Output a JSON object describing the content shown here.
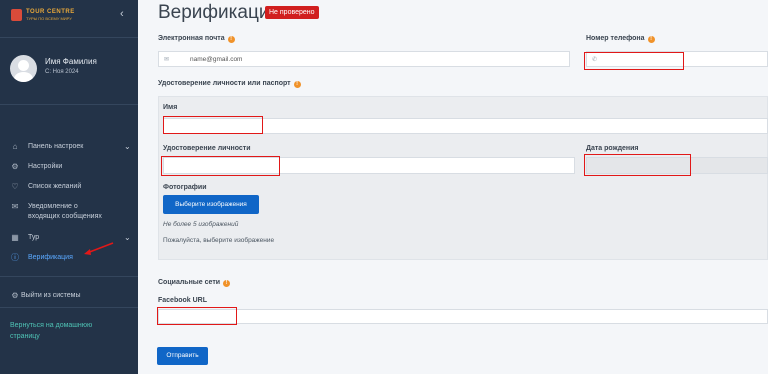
{
  "sidebar": {
    "brand_title": "TOUR CENTRE",
    "brand_sub": "ТУРЫ ПО ВСЕМУ МИРУ",
    "user_name": "Имя Фамилия",
    "user_since": "С: Ноя 2024",
    "items": [
      {
        "label": "Панель настроек",
        "icon": "house-icon"
      },
      {
        "label": "Настройки",
        "icon": "gear-icon"
      },
      {
        "label": "Список желаний",
        "icon": "heart-icon"
      },
      {
        "label": "Уведомление о входящих сообщениях",
        "icon": "message-icon"
      },
      {
        "label": "Тур",
        "icon": "map-icon"
      },
      {
        "label": "Верификация",
        "icon": "info-circle-icon"
      },
      {
        "label": "Выйти из системы",
        "icon": "gear-icon"
      }
    ],
    "back_link": "Вернуться на домашнюю страницу"
  },
  "main": {
    "title": "Верификация",
    "status": "Не проверено",
    "email_label": "Электронная почта",
    "email_value": "name@gmail.com",
    "phone_label": "Номер телефона",
    "phone_value": "",
    "id_section_label": "Удостоверение личности или паспорт",
    "name_label": "Имя",
    "id_label": "Удостоверение личности",
    "dob_label": "Дата рождения",
    "photos_label": "Фотографии",
    "select_images_button": "Выберите изображения",
    "max_images_note": "Не более 5 изображений",
    "select_image_prompt": "Пожалуйста, выберите изображение",
    "social_label": "Социальные сети",
    "facebook_label": "Facebook URL",
    "submit_button": "Отправить"
  },
  "colors": {
    "sidebar_bg": "#233348",
    "accent": "#1066c7",
    "badge": "#d11f1f",
    "active": "#5aa8ff",
    "link": "#4fc3b5"
  }
}
